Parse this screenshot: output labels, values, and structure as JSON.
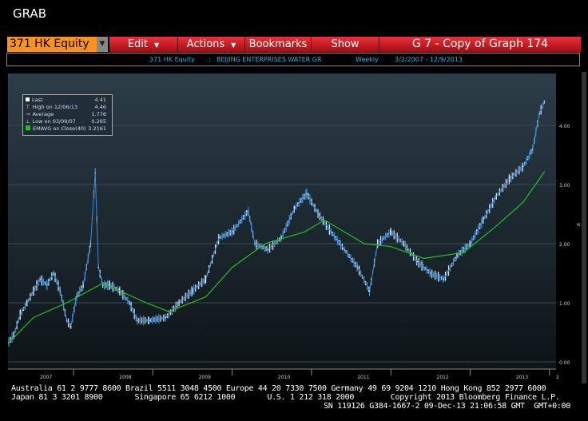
{
  "window": {
    "title": "GRAB"
  },
  "toolbar": {
    "ticker": "371 HK Equity",
    "menus": [
      "Edit",
      "Actions",
      "Bookmarks",
      "Show"
    ],
    "graph_title": "G 7 - Copy of Graph 174"
  },
  "info_bar": {
    "ticker": "371 HK Equity",
    "separator": ":",
    "name": "BEIJING ENTERPRISES WATER GR",
    "period": "Weekly",
    "range": "3/2/2007  -  12/9/2013"
  },
  "legend": [
    {
      "label": "Last",
      "value": "4.41",
      "icon": "square-white"
    },
    {
      "label": "High on 12/06/13",
      "value": "4.46",
      "icon": "high-marker"
    },
    {
      "label": "Average",
      "value": "1.776",
      "icon": "average-marker"
    },
    {
      "label": "Low on 03/09/07",
      "value": "0.265",
      "icon": "low-marker"
    },
    {
      "label": "EMAVG on Close(40)",
      "value": "3.2161",
      "icon": "square-green"
    }
  ],
  "colors": {
    "price": "#3a8fe0",
    "price_bars": "#e8e8e8",
    "ema": "#22c022",
    "background_top": "#2c3d48",
    "background_bottom": "#0e1418"
  },
  "chart_data": {
    "type": "line",
    "title": "",
    "ylim": [
      -0.1,
      4.8
    ],
    "y_ticks": [
      "0.00",
      "1.00",
      "2.00",
      "3.00",
      "4.00"
    ],
    "x_ticks": [
      "2007",
      "2008",
      "2009",
      "2010",
      "2011",
      "2012",
      "2013",
      "2"
    ],
    "x_range": [
      "2007-03-02",
      "2013-12-09"
    ],
    "grid": true,
    "series": [
      {
        "name": "Last",
        "x": [
          "2007-03-02",
          "2007-04-01",
          "2007-05-01",
          "2007-06-01",
          "2007-07-01",
          "2007-08-01",
          "2007-09-01",
          "2007-10-01",
          "2007-11-01",
          "2007-12-01",
          "2007-12-20",
          "2008-01-15",
          "2008-02-15",
          "2008-03-20",
          "2008-04-10",
          "2008-04-25",
          "2008-05-15",
          "2008-06-15",
          "2008-08-01",
          "2008-09-15",
          "2008-10-20",
          "2008-12-15",
          "2009-03-01",
          "2009-05-01",
          "2009-07-01",
          "2009-09-01",
          "2009-11-01",
          "2010-01-01",
          "2010-03-15",
          "2010-04-15",
          "2010-06-15",
          "2010-08-15",
          "2010-10-15",
          "2010-12-10",
          "2011-02-01",
          "2011-04-01",
          "2011-06-01",
          "2011-08-01",
          "2011-09-25",
          "2011-11-01",
          "2012-01-01",
          "2012-03-01",
          "2012-05-01",
          "2012-07-01",
          "2012-09-01",
          "2012-11-01",
          "2013-01-01",
          "2013-03-01",
          "2013-05-01",
          "2013-07-01",
          "2013-09-01",
          "2013-10-15",
          "2013-11-15",
          "2013-12-09"
        ],
        "y": [
          0.3,
          0.45,
          0.8,
          1.0,
          1.2,
          1.4,
          1.3,
          1.5,
          1.2,
          0.7,
          0.6,
          1.1,
          1.3,
          2.0,
          3.2,
          1.6,
          1.3,
          1.3,
          1.2,
          1.0,
          0.7,
          0.7,
          0.75,
          1.0,
          1.2,
          1.4,
          2.1,
          2.2,
          2.55,
          2.0,
          1.9,
          2.1,
          2.6,
          2.85,
          2.5,
          2.2,
          1.9,
          1.6,
          1.2,
          2.0,
          2.2,
          2.0,
          1.7,
          1.5,
          1.4,
          1.8,
          2.0,
          2.4,
          2.8,
          3.1,
          3.3,
          3.6,
          4.2,
          4.41
        ]
      },
      {
        "name": "EMAVG on Close(40)",
        "x": [
          "2007-03-02",
          "2007-07-01",
          "2007-12-01",
          "2008-05-15",
          "2008-12-01",
          "2009-03-15",
          "2009-09-01",
          "2010-01-01",
          "2010-06-01",
          "2010-12-01",
          "2011-03-01",
          "2011-09-01",
          "2012-01-01",
          "2012-06-01",
          "2012-12-01",
          "2013-05-01",
          "2013-09-01",
          "2013-12-09"
        ],
        "y": [
          0.3,
          0.75,
          1.0,
          1.33,
          1.0,
          0.85,
          1.1,
          1.6,
          2.0,
          2.2,
          2.4,
          2.0,
          1.95,
          1.75,
          1.85,
          2.3,
          2.7,
          3.22
        ]
      }
    ]
  },
  "footer": {
    "line1": "Australia 61 2 9777 8600 Brazil 5511 3048 4500 Europe 44 20 7330 7500 Germany 49 69 9204 1210 Hong Kong 852 2977 6000",
    "line2": "Japan 81 3 3201 8900       Singapore 65 6212 1000       U.S. 1 212 318 2000        Copyright 2013 Bloomberg Finance L.P.",
    "line3": "SN 119126 G384-1667-2 09-Dec-13 21:06:58 GMT  GMT+0:00"
  }
}
